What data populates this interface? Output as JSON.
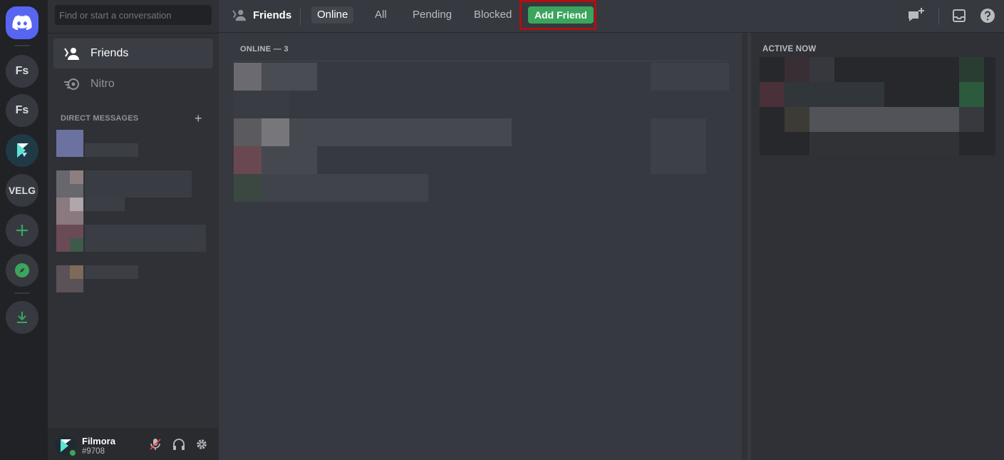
{
  "rail": {
    "servers": [
      {
        "label": "Fs"
      },
      {
        "label": "Fs"
      },
      {
        "label": ""
      },
      {
        "label": "VELG"
      }
    ]
  },
  "sidebar": {
    "search_placeholder": "Find or start a conversation",
    "nav": [
      {
        "label": "Friends",
        "icon": "friends-icon"
      },
      {
        "label": "Nitro",
        "icon": "nitro-icon"
      }
    ],
    "direct_messages_heading": "DIRECT MESSAGES"
  },
  "user": {
    "name": "Filmora",
    "tag": "#9708"
  },
  "header": {
    "title": "Friends",
    "tabs": [
      {
        "label": "Online"
      },
      {
        "label": "All"
      },
      {
        "label": "Pending"
      },
      {
        "label": "Blocked"
      }
    ],
    "add_friend_label": "Add Friend"
  },
  "friends": {
    "section_heading": "ONLINE — 3"
  },
  "active_now": {
    "heading": "ACTIVE NOW"
  },
  "colors": {
    "brand": "#5865f2",
    "green": "#3ba55d",
    "highlight": "#b01010"
  }
}
